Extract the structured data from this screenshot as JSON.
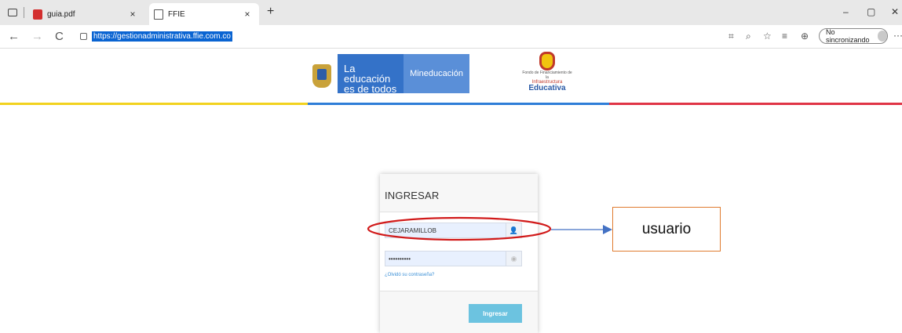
{
  "tabs": [
    {
      "title": "guia.pdf",
      "close": "×"
    },
    {
      "title": "FFIE",
      "close": "×"
    }
  ],
  "new_tab": "+",
  "window_controls": {
    "minimize": "–",
    "maximize": "▢",
    "close": "✕"
  },
  "nav": {
    "back": "←",
    "forward": "→",
    "refresh": "C"
  },
  "address_bar": {
    "url": "https://gestionadministrativa.ffie.com.co"
  },
  "toolbar": {
    "sync_label": "No sincronizando",
    "more": "···"
  },
  "header": {
    "brand_text": "La educación es de todos",
    "brand_ministry": "Mineducación",
    "ffie_small": "Fondo de Financiamiento de la",
    "ffie_infra": "Infraestructura",
    "ffie_edu": "Educativa",
    "stripe_colors": [
      "#f2d21f",
      "#2f7ed8",
      "#e03546"
    ]
  },
  "login": {
    "title": "INGRESAR",
    "username_value": "CEJARAMILLOB",
    "password_value": "••••••••••",
    "forgot_link": "¿Olvidó su contraseña?",
    "submit_label": "Ingresar"
  },
  "annotation": {
    "label": "usuario",
    "ellipse_color": "#d11a1a",
    "arrow_color": "#4472c4"
  }
}
